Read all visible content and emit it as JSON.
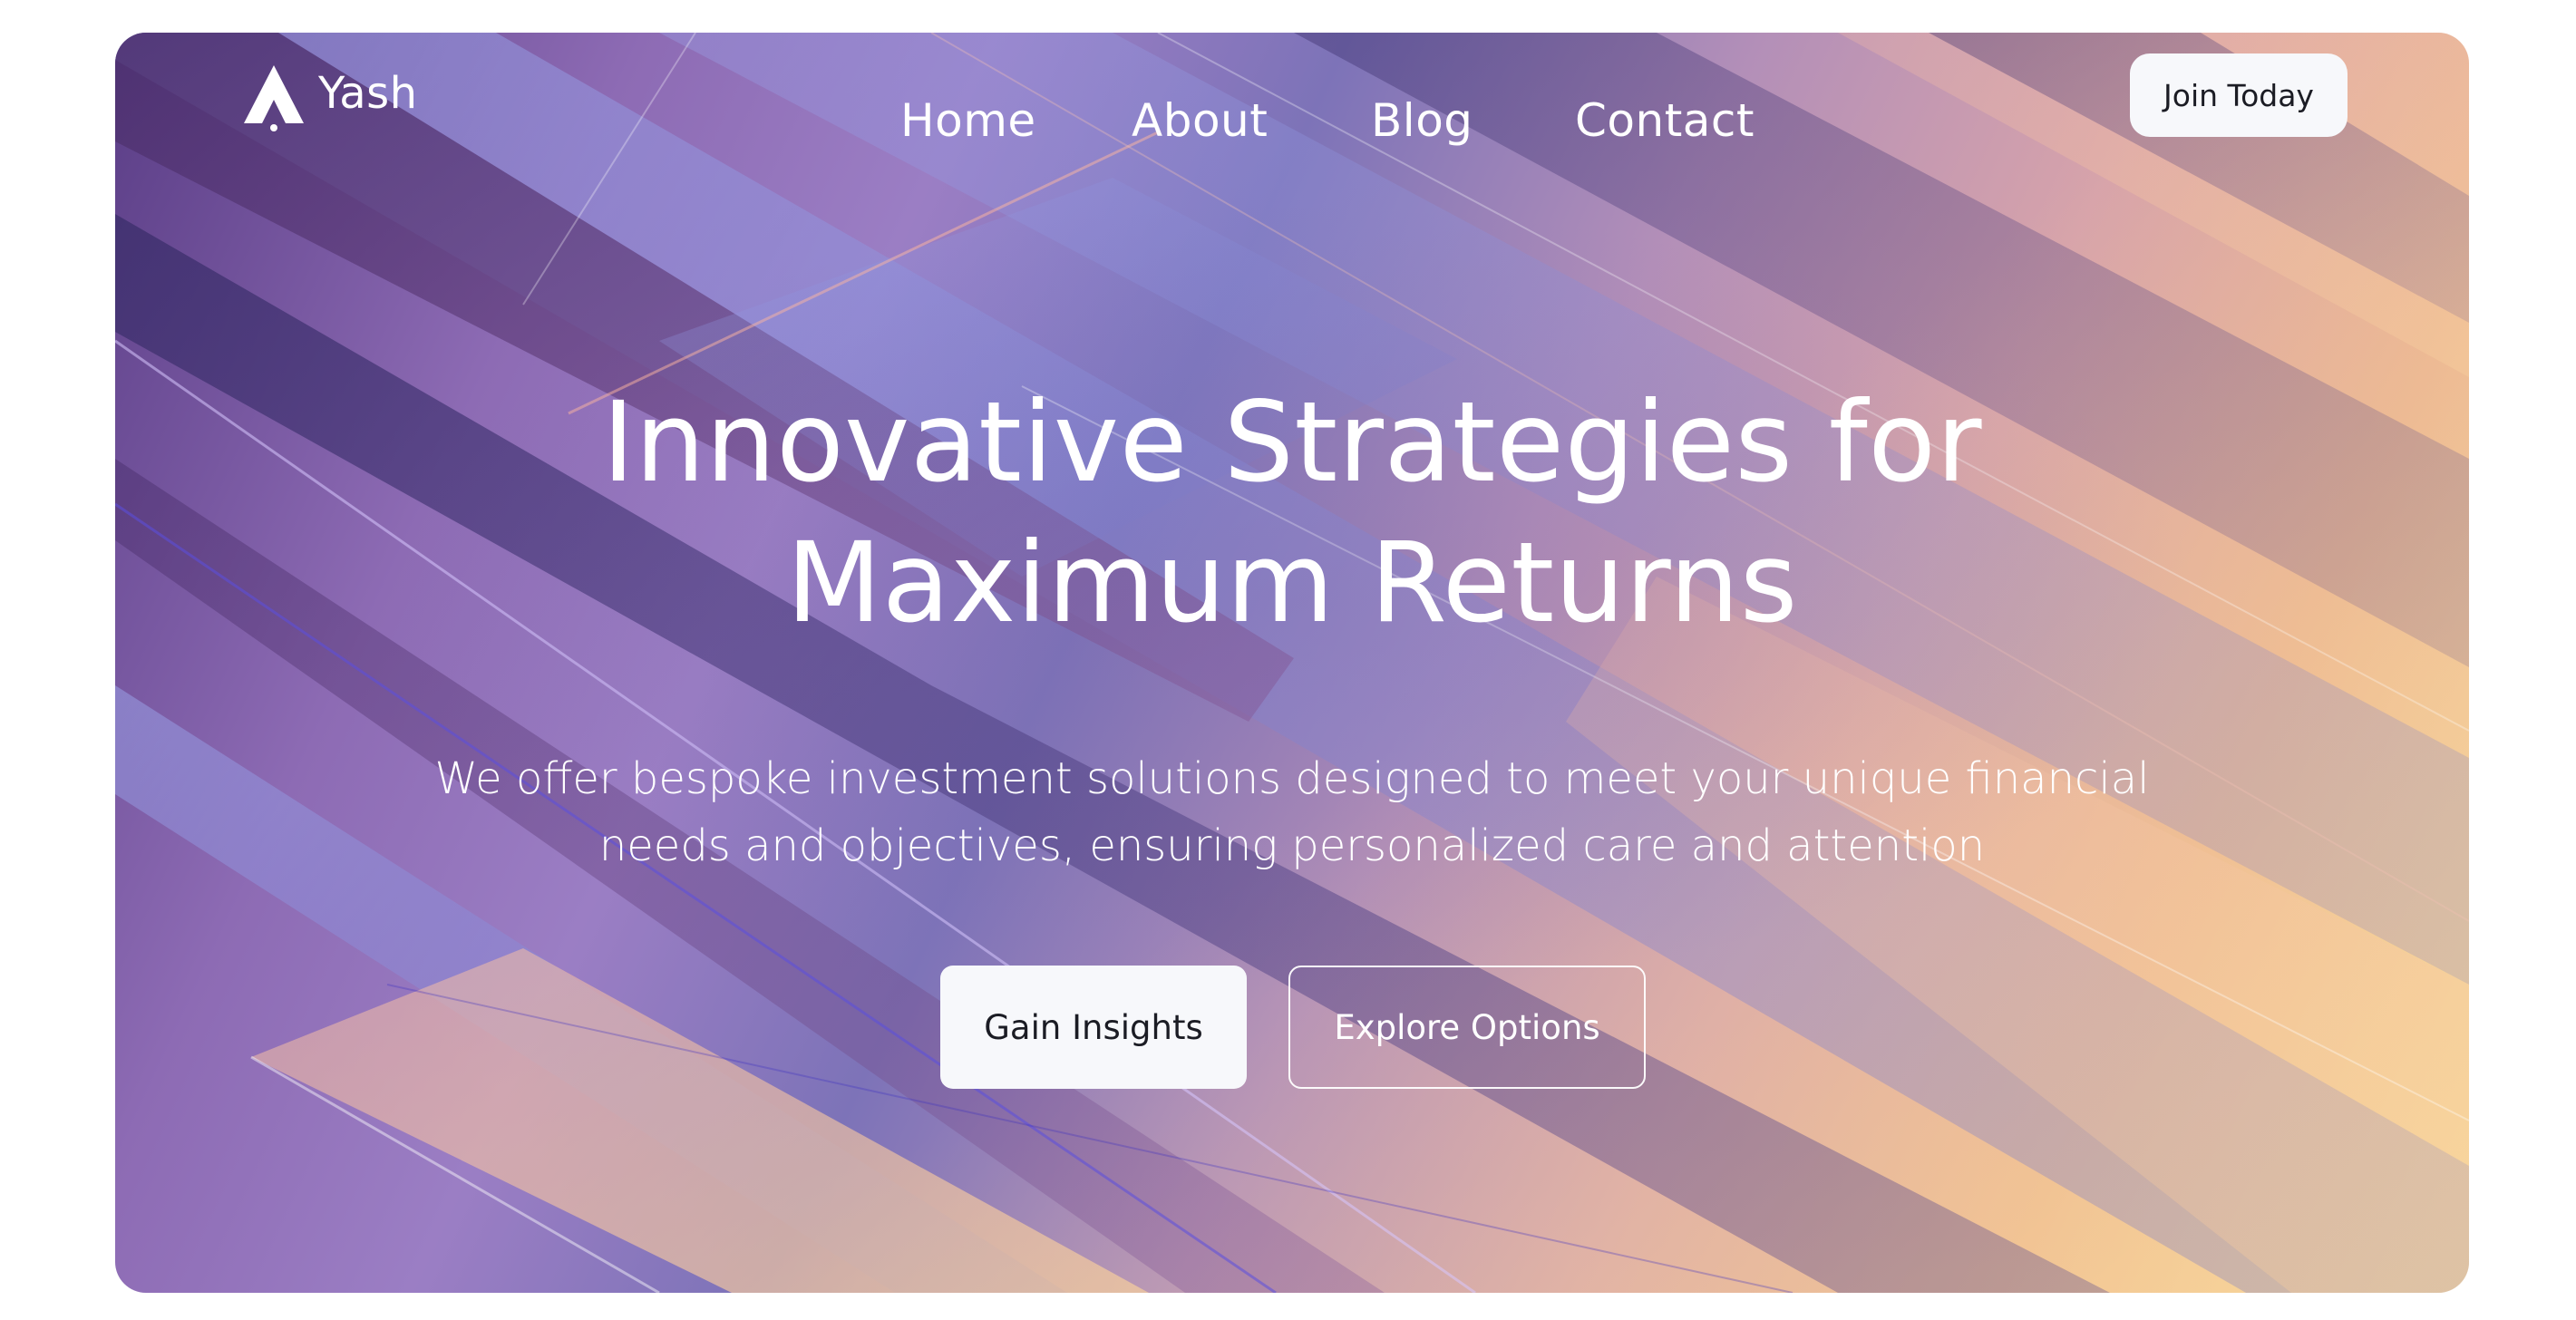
{
  "brand": {
    "name": "Yash",
    "logo_icon": "rocket-icon"
  },
  "nav": {
    "items": [
      {
        "label": "Home"
      },
      {
        "label": "About"
      },
      {
        "label": "Blog"
      },
      {
        "label": "Contact"
      }
    ],
    "cta_label": "Join Today"
  },
  "hero": {
    "headline_line1": "Innovative Strategies for",
    "headline_line2": "Maximum Returns",
    "subtext_line1": "We offer bespoke investment solutions designed to meet your unique financial",
    "subtext_line2": "needs and objectives, ensuring personalized care and attention",
    "primary_button": "Gain Insights",
    "secondary_button": "Explore Options"
  },
  "colors": {
    "button_bg": "#f7f8fb",
    "button_text": "#1b1c24",
    "text_on_hero": "#ffffff",
    "gradient_purple": "#8d6bb4",
    "gradient_peach": "#e9b193"
  }
}
